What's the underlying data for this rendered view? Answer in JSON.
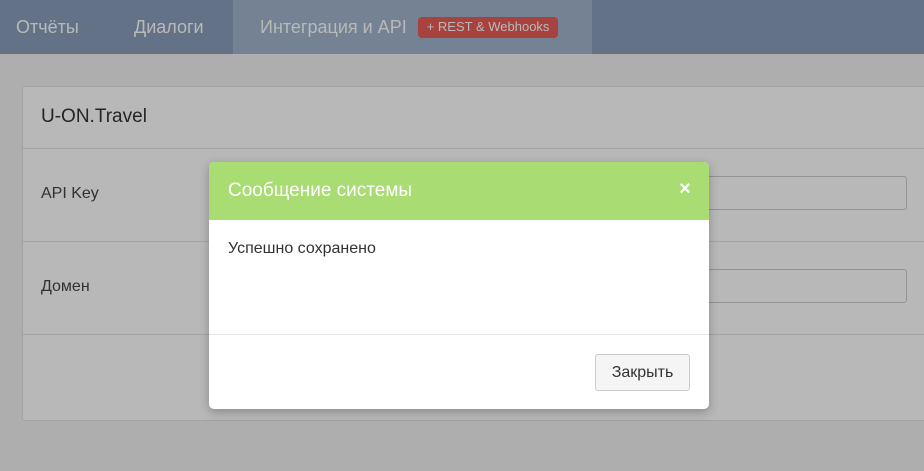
{
  "nav": {
    "tabs": [
      {
        "label": "Отчёты"
      },
      {
        "label": "Диалоги"
      },
      {
        "label": "Интеграция и API",
        "badge": "+ REST & Webhooks",
        "active": true
      }
    ]
  },
  "panel": {
    "title": "U-ON.Travel",
    "fields": [
      {
        "label": "API Key",
        "value": ""
      },
      {
        "label": "Домен",
        "value": ""
      }
    ]
  },
  "modal": {
    "title": "Сообщение системы",
    "close_icon": "×",
    "message": "Успешно сохранено",
    "button_label": "Закрыть"
  },
  "colors": {
    "nav_bg": "#8b9fbb",
    "nav_active_bg": "#a2b4cd",
    "badge": "#e95c56",
    "modal_header": "#a9dc72"
  }
}
